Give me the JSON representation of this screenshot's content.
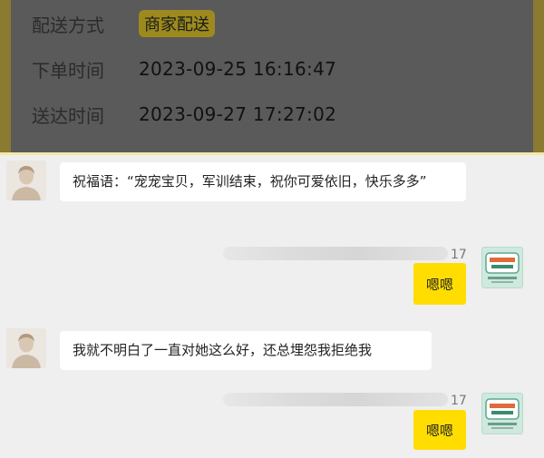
{
  "order": {
    "rows": [
      {
        "label": "配送方式",
        "value": "商家配送"
      },
      {
        "label": "下单时间",
        "value": "2023-09-25 16:16:47"
      },
      {
        "label": "送达时间",
        "value": "2023-09-27 17:27:02"
      }
    ]
  },
  "chat": {
    "messages": [
      {
        "text": "祝福语：“宠宠宝贝，军训结束，祝你可爱依旧，快乐多多”"
      },
      {
        "time": "17",
        "reply": "嗯嗯"
      },
      {
        "text": "我就不明白了一直对她这么好，还总埋怨我拒绝我"
      },
      {
        "time": "17",
        "reply": "嗯嗯"
      }
    ]
  },
  "icons": {
    "male_avatar": "male-avatar-icon",
    "brand_avatar": "shop-brand-avatar-icon"
  },
  "colors": {
    "bubble_out": "#ffdd00",
    "bubble_in": "#ffffff",
    "overlay": "#5a5a5a"
  }
}
